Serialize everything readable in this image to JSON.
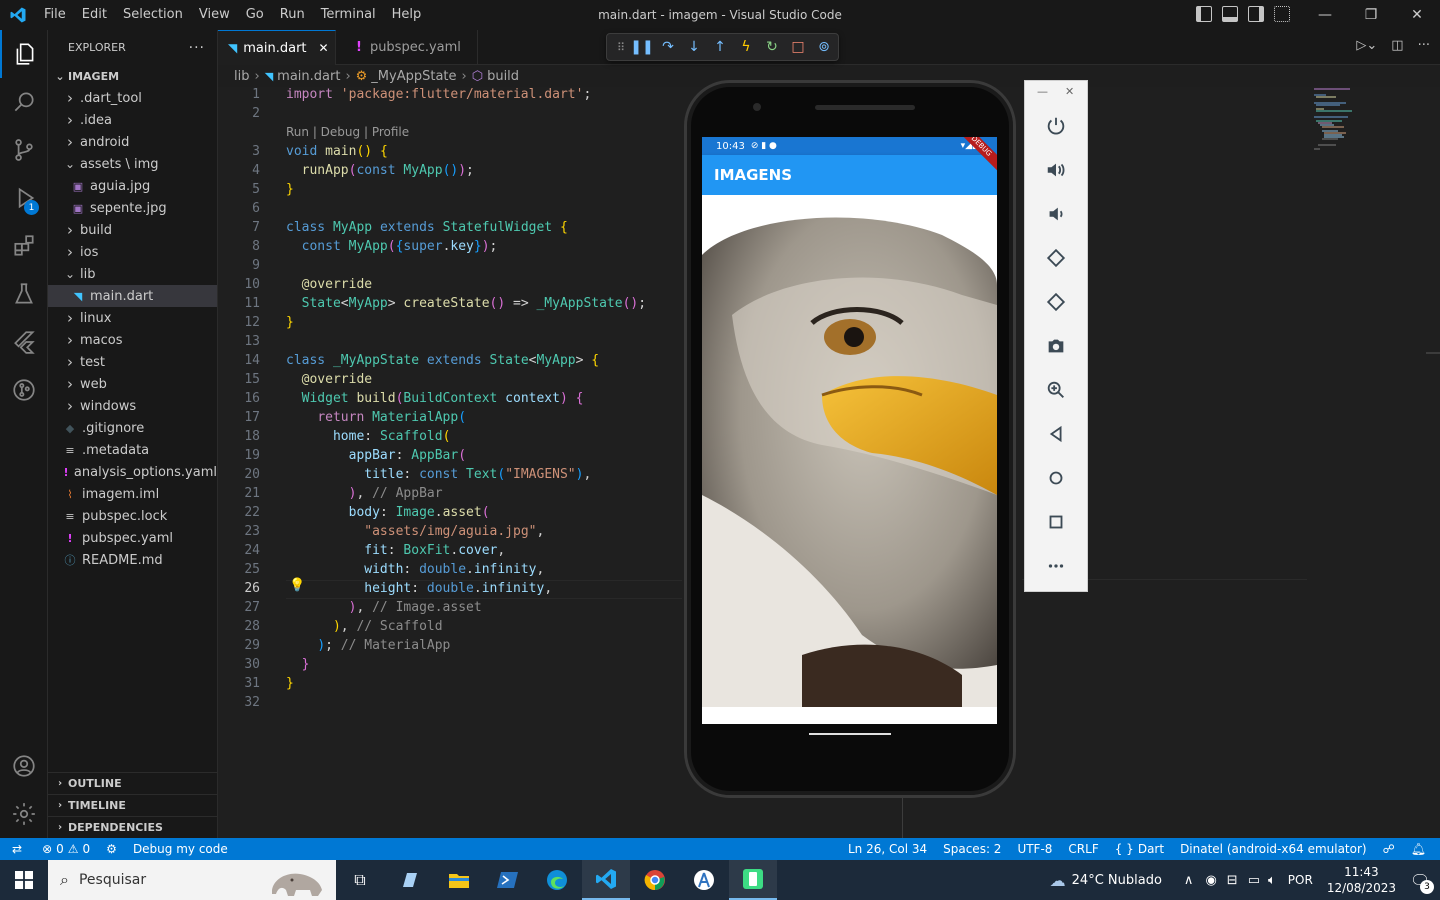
{
  "window": {
    "title": "main.dart - imagem - Visual Studio Code"
  },
  "menu": [
    "File",
    "Edit",
    "Selection",
    "View",
    "Go",
    "Run",
    "Terminal",
    "Help"
  ],
  "explorer": {
    "header": "EXPLORER",
    "more": "···",
    "root": "IMAGEM",
    "items": [
      {
        "label": ".dart_tool",
        "depth": 1,
        "kind": "folder",
        "open": false
      },
      {
        "label": ".idea",
        "depth": 1,
        "kind": "folder",
        "open": false
      },
      {
        "label": "android",
        "depth": 1,
        "kind": "folder",
        "open": false
      },
      {
        "label": "assets \\ img",
        "depth": 1,
        "kind": "folder",
        "open": true
      },
      {
        "label": "aguia.jpg",
        "depth": 2,
        "kind": "image"
      },
      {
        "label": "sepente.jpg",
        "depth": 2,
        "kind": "image"
      },
      {
        "label": "build",
        "depth": 1,
        "kind": "folder",
        "open": false
      },
      {
        "label": "ios",
        "depth": 1,
        "kind": "folder",
        "open": false
      },
      {
        "label": "lib",
        "depth": 1,
        "kind": "folder",
        "open": true
      },
      {
        "label": "main.dart",
        "depth": 2,
        "kind": "dart",
        "selected": true
      },
      {
        "label": "linux",
        "depth": 1,
        "kind": "folder",
        "open": false
      },
      {
        "label": "macos",
        "depth": 1,
        "kind": "folder",
        "open": false
      },
      {
        "label": "test",
        "depth": 1,
        "kind": "folder",
        "open": false
      },
      {
        "label": "web",
        "depth": 1,
        "kind": "folder",
        "open": false
      },
      {
        "label": "windows",
        "depth": 1,
        "kind": "folder",
        "open": false
      },
      {
        "label": ".gitignore",
        "depth": 1,
        "kind": "git"
      },
      {
        "label": ".metadata",
        "depth": 1,
        "kind": "lines"
      },
      {
        "label": "analysis_options.yaml",
        "depth": 1,
        "kind": "yaml"
      },
      {
        "label": "imagem.iml",
        "depth": 1,
        "kind": "rss"
      },
      {
        "label": "pubspec.lock",
        "depth": 1,
        "kind": "lines"
      },
      {
        "label": "pubspec.yaml",
        "depth": 1,
        "kind": "yaml"
      },
      {
        "label": "README.md",
        "depth": 1,
        "kind": "info"
      }
    ],
    "sections": [
      "OUTLINE",
      "TIMELINE",
      "DEPENDENCIES"
    ]
  },
  "tabs": [
    {
      "label": "main.dart",
      "close": "✕",
      "active": true
    },
    {
      "label": "pubspec.yaml",
      "active": false
    }
  ],
  "breadcrumb": [
    "lib",
    "main.dart",
    "_MyAppState",
    "build"
  ],
  "codelens": "Run | Debug | Profile",
  "line_numbers": [
    "1",
    "2",
    "3",
    "4",
    "5",
    "6",
    "7",
    "8",
    "9",
    "10",
    "11",
    "12",
    "13",
    "14",
    "15",
    "16",
    "17",
    "18",
    "19",
    "20",
    "21",
    "22",
    "23",
    "24",
    "25",
    "26",
    "27",
    "28",
    "29",
    "30",
    "31",
    "32"
  ],
  "current_line": "26",
  "emulator": {
    "time": "10:43",
    "app_title": "IMAGENS",
    "debug_banner": "DEBUG",
    "image_asset": "assets/img/aguia.jpg"
  },
  "emulator_toolbar": [
    "power-icon",
    "volume-up-icon",
    "volume-down-icon",
    "rotate-left-icon",
    "rotate-right-icon",
    "camera-icon",
    "zoom-icon",
    "back-icon",
    "home-icon",
    "overview-icon",
    "more-icon"
  ],
  "statusbar": {
    "errors": "0",
    "warnings": "0",
    "debug_label": "Debug my code",
    "position": "Ln 26, Col 34",
    "spaces": "Spaces: 2",
    "encoding": "UTF-8",
    "eol": "CRLF",
    "language": "Dart",
    "device": "Dinatel (android-x64 emulator)"
  },
  "taskbar": {
    "search_placeholder": "Pesquisar",
    "weather": "24°C  Nublado",
    "lang": "POR",
    "time": "11:43",
    "date": "12/08/2023",
    "notifications": "3"
  },
  "colors": {
    "accent": "#0078d4",
    "appbar": "#2196f3",
    "statusbar_android": "#1976d2"
  }
}
